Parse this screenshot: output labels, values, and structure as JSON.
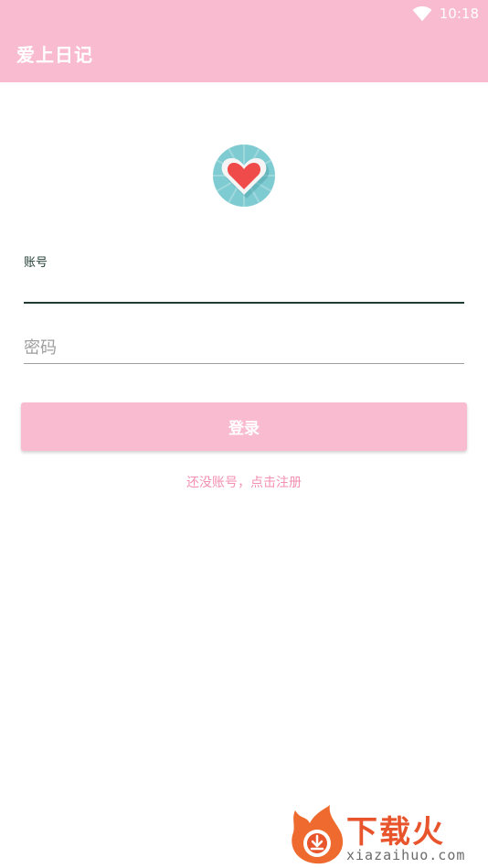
{
  "status_bar": {
    "time": "10:18",
    "wifi_icon": "wifi-icon"
  },
  "app_bar": {
    "title": "爱上日记",
    "background": "#f8bbd0"
  },
  "logo": {
    "icon": "heart-badge-icon"
  },
  "form": {
    "account": {
      "label": "账号",
      "value": ""
    },
    "password": {
      "placeholder": "密码",
      "value": ""
    },
    "login_label": "登录",
    "register_link": "还没账号，点击注册"
  },
  "watermark": {
    "brand": "下载火",
    "domain": "xiazaihuo.com"
  },
  "colors": {
    "accent_pink": "#f8bbd0",
    "link_pink": "#f48fb1",
    "underline_focus": "#1f3b32",
    "watermark_orange": "#e8542b"
  }
}
